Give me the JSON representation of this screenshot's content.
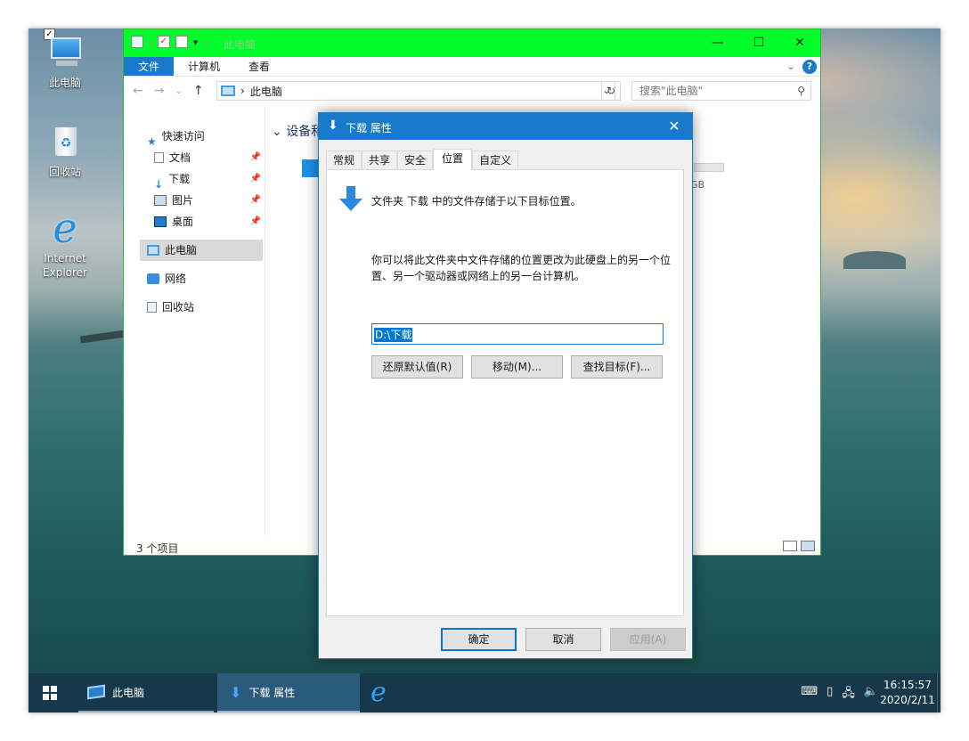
{
  "desktop": {
    "icons": [
      {
        "label": "此电脑"
      },
      {
        "label": "回收站"
      },
      {
        "label": "Internet Explorer"
      }
    ]
  },
  "explorer": {
    "title": "此电脑",
    "title_bar_color": "#00ff2a",
    "window_controls": {
      "minimize": "—",
      "maximize": "☐",
      "close": "✕"
    },
    "ribbon_tabs": [
      "文件",
      "计算机",
      "查看"
    ],
    "address": "此电脑",
    "search_placeholder": "搜索\"此电脑\"",
    "nav": {
      "quick_access": "快速访问",
      "pinned": [
        "文档",
        "下载",
        "图片",
        "桌面"
      ],
      "this_pc": "此电脑",
      "network": "网络",
      "recycle_bin": "回收站"
    },
    "section_header": "设备和",
    "drive_suffix": "GB",
    "status": "3 个项目"
  },
  "dialog": {
    "title": "下载 属性",
    "tabs": [
      "常规",
      "共享",
      "安全",
      "位置",
      "自定义"
    ],
    "active_tab": "位置",
    "intro": "文件夹 下载 中的文件存储于以下目标位置。",
    "description": "你可以将此文件夹中文件存储的位置更改为此硬盘上的另一个位置、另一个驱动器或网络上的另一台计算机。",
    "path": "D:\\下载",
    "buttons": {
      "restore": "还原默认值(R)",
      "move": "移动(M)...",
      "find": "查找目标(F)..."
    },
    "footer": {
      "ok": "确定",
      "cancel": "取消",
      "apply": "应用(A)"
    },
    "accent_color": "#1979ca"
  },
  "taskbar": {
    "items": [
      {
        "label": "此电脑"
      },
      {
        "label": "下载 属性"
      }
    ],
    "clock_time": "16:15:57",
    "clock_date": "2020/2/11"
  }
}
